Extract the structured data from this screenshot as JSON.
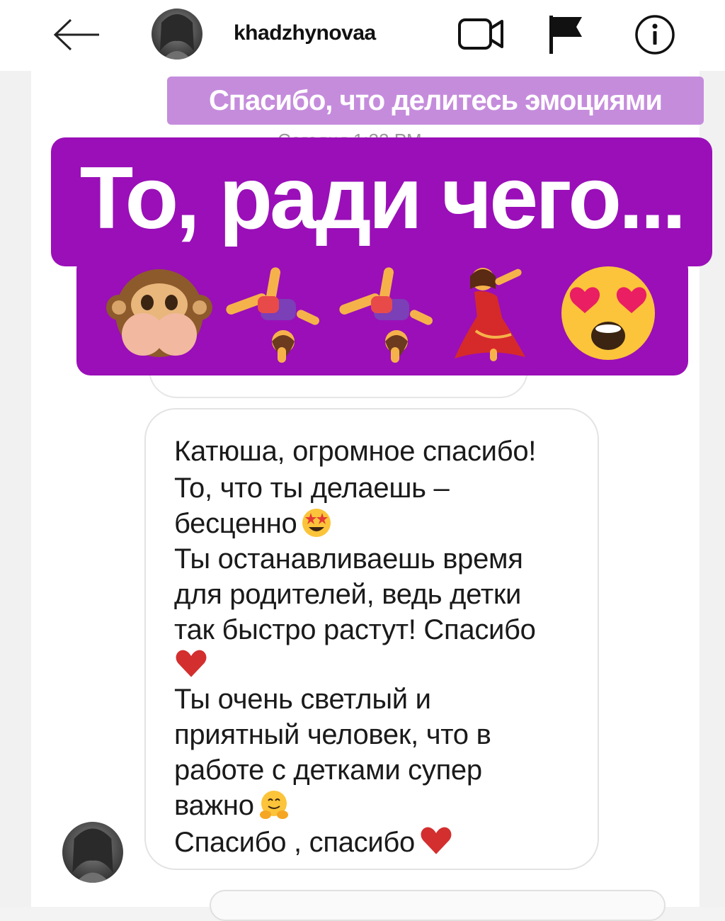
{
  "header": {
    "back_icon": "arrow-left-icon",
    "username": "khadzhynovaa",
    "video_icon": "video-camera-icon",
    "flag_icon": "flag-icon",
    "info_icon": "info-icon"
  },
  "overlay": {
    "subtitle": "Спасибо, что делитесь эмоциями",
    "timestamp": "Сегодня 1:22 PM",
    "title": "То, ради чего...",
    "emojis": [
      "see-no-evil-monkey",
      "woman-cartwheeling",
      "woman-cartwheeling",
      "woman-dancing",
      "heart-eyes-face"
    ],
    "colors": {
      "subtitle_bg": "#c58cdc",
      "title_bg": "#9a0fb8"
    }
  },
  "message": {
    "lines": [
      "Катюша, огромное спасибо!",
      "То, что ты делаешь –",
      "бесценно",
      "Ты останавливаешь время",
      "для родителей, ведь детки",
      "так быстро растут! Спасибо",
      "",
      "Ты очень светлый и",
      "приятный человек, что в",
      "работе с детками супер",
      "важно",
      "Спасибо , спасибо"
    ],
    "inline_emojis": {
      "line_3": "star-struck",
      "line_7": "red-heart",
      "line_11": "hugging-face",
      "line_12": "red-heart"
    }
  }
}
